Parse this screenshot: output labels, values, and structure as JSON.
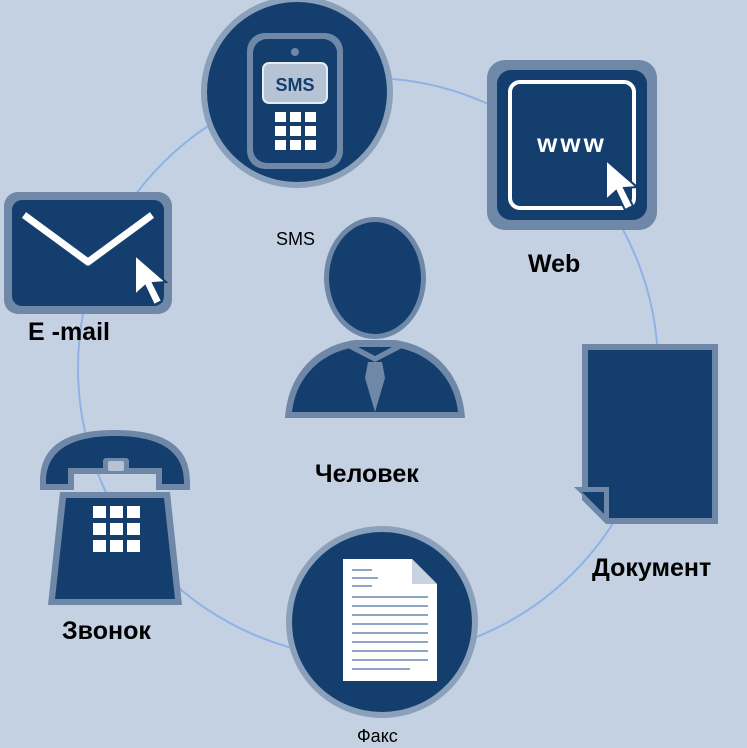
{
  "nodes": {
    "sms": {
      "label": "SMS",
      "screen_text": "SMS"
    },
    "web": {
      "label": "Web",
      "screen_text": "www"
    },
    "email": {
      "label": "E -mail"
    },
    "person": {
      "label": "Человек"
    },
    "document": {
      "label": "Документ"
    },
    "call": {
      "label": "Звонок"
    },
    "fax": {
      "label": "Факс"
    }
  },
  "colors": {
    "background": "#c3d1e3",
    "icon_fill": "#133e6e",
    "icon_border": "#6f88a8",
    "ring": "#8fb2e6",
    "screen_fill": "#b6c3d4"
  },
  "icons": [
    "mobile-phone-icon",
    "browser-cursor-icon",
    "envelope-icon",
    "person-icon",
    "document-icon",
    "telephone-icon",
    "fax-document-icon"
  ]
}
